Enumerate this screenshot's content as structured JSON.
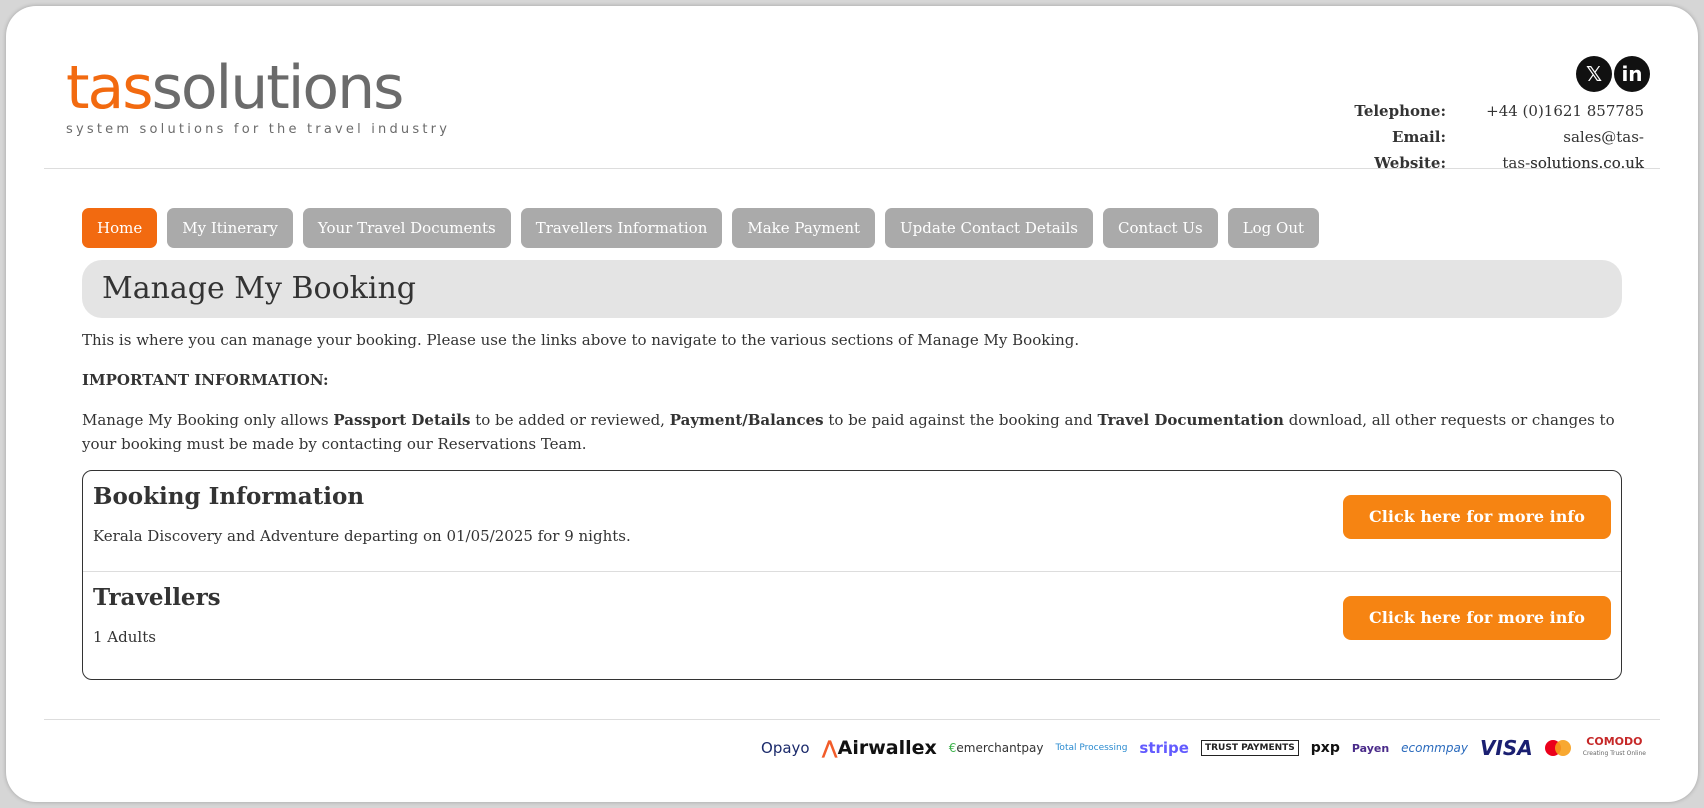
{
  "header": {
    "logo_part1": "tas",
    "logo_part2": "solutions",
    "tagline": "system solutions for the travel industry",
    "social": [
      {
        "icon": "x-twitter-icon",
        "glyph": "𝕏"
      },
      {
        "icon": "linkedin-icon",
        "glyph": "in"
      }
    ],
    "contact": [
      {
        "label": "Telephone:",
        "value": "+44 (0)1621 857785"
      },
      {
        "label": "Email:",
        "value": "sales@tas-solutions.co.uk"
      },
      {
        "label": "Website:",
        "value": "tas-solutions.co.uk"
      }
    ]
  },
  "nav": {
    "items": [
      {
        "label": "Home",
        "active": true
      },
      {
        "label": "My Itinerary"
      },
      {
        "label": "Your Travel Documents"
      },
      {
        "label": "Travellers Information"
      },
      {
        "label": "Make Payment"
      },
      {
        "label": "Update Contact Details"
      },
      {
        "label": "Contact Us"
      },
      {
        "label": "Log Out"
      }
    ]
  },
  "main": {
    "title": "Manage My Booking",
    "intro": "This is where you can manage your booking. Please use the links above to navigate to the various sections of Manage My Booking.",
    "important_heading": "IMPORTANT INFORMATION:",
    "notice": {
      "t1": "Manage My Booking only allows ",
      "b1": "Passport Details",
      "t2": " to be added or reviewed, ",
      "b2": "Payment/Balances",
      "t3": " to be paid against the booking and ",
      "b3": "Travel Documentation",
      "t4": " download, all other requests or changes to your booking must be made by contacting our Reservations Team."
    },
    "sections": [
      {
        "title": "Booking Information",
        "desc": "Kerala Discovery and Adventure departing on 01/05/2025 for 9 nights.",
        "button": "Click here for more info"
      },
      {
        "title": "Travellers",
        "desc": "1 Adults",
        "button": "Click here for more info"
      }
    ]
  },
  "footer": {
    "payments": {
      "opayo": "Opayo",
      "airwallex": "Airwallex",
      "emerchantpay": "emerchantpay",
      "total_processing": "Total Processing",
      "stripe": "stripe",
      "trust_payments": "TRUST PAYMENTS",
      "pxp": "pxp",
      "payen": "Payen",
      "ecommpay": "ecommpay",
      "visa": "VISA",
      "comodo": "COMODO",
      "comodo_sub": "Creating Trust Online"
    }
  }
}
